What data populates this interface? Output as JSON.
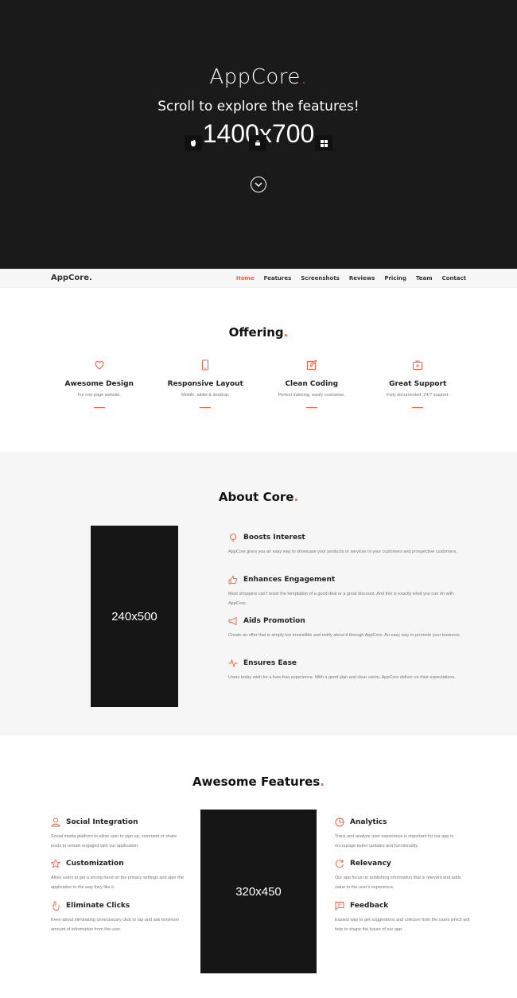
{
  "hero": {
    "brand": "AppCore",
    "brand_dot": ".",
    "subtitle": "Scroll to explore the features!",
    "image_placeholder": "1400x700"
  },
  "nav": {
    "logo": "AppCore.",
    "links": [
      "Home",
      "Features",
      "Screenshots",
      "Reviews",
      "Pricing",
      "Team",
      "Contact"
    ],
    "active": "Home"
  },
  "offering": {
    "title": "Offering",
    "dot": ".",
    "items": [
      {
        "icon": "heart-icon",
        "title": "Awesome Design",
        "desc": "For one page website."
      },
      {
        "icon": "mobile-icon",
        "title": "Responsive Layout",
        "desc": "Mobile, tablet & desktop."
      },
      {
        "icon": "edit-icon",
        "title": "Clean Coding",
        "desc": "Perfect indexing, easily customise."
      },
      {
        "icon": "support-icon",
        "title": "Great Support",
        "desc": "Fully documented, 24/7 support."
      }
    ]
  },
  "about": {
    "title": "About Core",
    "dot": ".",
    "image_placeholder": "240x500",
    "items": [
      {
        "icon": "bulb-icon",
        "title": "Boosts Interest",
        "text": "AppCore gives you an easy way to showcase your products or services to your customers and prospective customers."
      },
      {
        "icon": "thumbs-up-icon",
        "title": "Enhances Engagement",
        "text": "Most shoppers can't resist the temptation of a good deal or a great discount. And this is exactly what you can do with AppCore."
      },
      {
        "icon": "megaphone-icon",
        "title": "Aids Promotion",
        "text": "Create an offer that is simply too irresistible and notify about it through AppCore. An easy way to promote your business."
      },
      {
        "icon": "pulse-icon",
        "title": "Ensures Ease",
        "text": "Users today wish for a fuss-free experience. With a good plan and clear vision, AppCore deliver on their expectations."
      }
    ]
  },
  "features": {
    "title": "Awesome Features",
    "dot": ".",
    "image_placeholder": "320x450",
    "left": [
      {
        "icon": "user-icon",
        "title": "Social Integration",
        "text": "Social media platform to allow user to sign up, comment or share posts to remain engaged with our application."
      },
      {
        "icon": "star-icon",
        "title": "Customization",
        "text": "Allow users to get a strong hand on the privacy settings and alter the application to the way they like it."
      },
      {
        "icon": "pointer-icon",
        "title": "Eliminate Clicks",
        "text": "Keen about eliminating unnecessary click or tap and ask minimum amount of information from the user."
      }
    ],
    "right": [
      {
        "icon": "pie-chart-icon",
        "title": "Analytics",
        "text": "Track and analyze user experience is important for our app to encourage better updates and functionality."
      },
      {
        "icon": "refresh-icon",
        "title": "Relevancy",
        "text": "Our app focus on publishing information that is relevant and adds value to the user's experience."
      },
      {
        "icon": "chat-icon",
        "title": "Feedback",
        "text": "Easiest way to get suggestions and criticism from the users which will help to shape the future of our app."
      }
    ]
  },
  "colors": {
    "accent": "#f0634b",
    "hero_bg": "#1a1a1a",
    "about_bg": "#f6f6f6",
    "placeholder_bg": "#161616"
  }
}
